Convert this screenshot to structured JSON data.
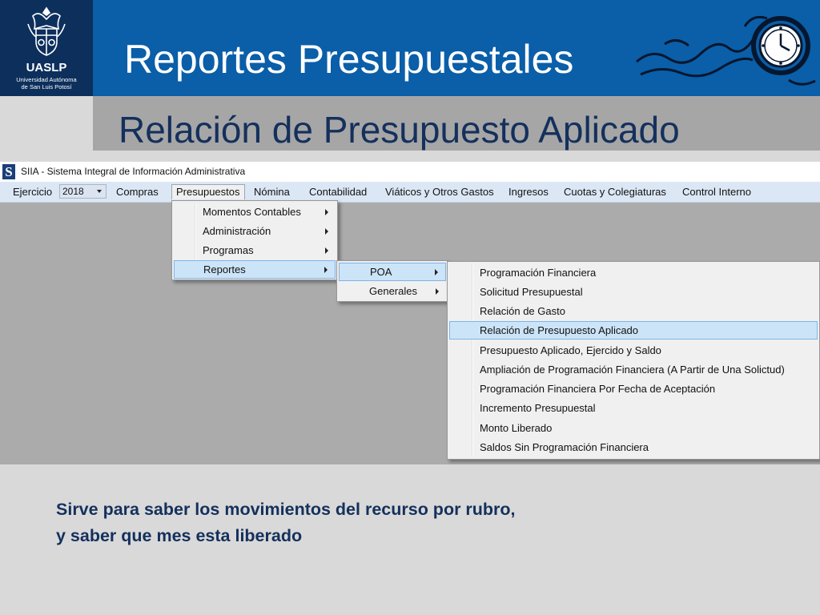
{
  "slide": {
    "logo": {
      "name": "UASLP",
      "line1": "Universidad Autónoma",
      "line2": "de San Luis Potosí"
    },
    "title": "Reportes Presupuestales",
    "subtitle": "Relación de Presupuesto Aplicado",
    "description": [
      "Sirve para saber los movimientos del recurso por rubro,",
      "y saber que mes esta liberado"
    ]
  },
  "app": {
    "window_title": "SIIA - Sistema Integral de Información Administrativa",
    "icon_letter": "S",
    "menubar": {
      "ejercicio_label": "Ejercicio",
      "year_value": "2018",
      "items": [
        "Compras",
        "Presupuestos",
        "Nómina",
        "Contabilidad",
        "Viáticos y Otros Gastos",
        "Ingresos",
        "Cuotas y Colegiaturas",
        "Control Interno"
      ]
    },
    "presupuestos_menu": [
      "Momentos Contables",
      "Administración",
      "Programas",
      "Reportes"
    ],
    "reportes_menu": [
      "POA",
      "Generales"
    ],
    "poa_menu": [
      "Programación Financiera",
      "Solicitud Presupuestal",
      "Relación de Gasto",
      "Relación de Presupuesto Aplicado",
      "Presupuesto Aplicado, Ejercido y Saldo",
      "Ampliación de Programación Financiera (A Partir de Una Solictud)",
      "Programación Financiera Por Fecha de Aceptación",
      "Incremento Presupuestal",
      "Monto Liberado",
      "Saldos Sin Programación Financiera"
    ],
    "selected": {
      "menu": "Presupuestos",
      "submenu": "Reportes",
      "subsubmenu": "POA",
      "item": "Relación de Presupuesto Aplicado"
    }
  },
  "colors": {
    "header_blue": "#0b5ea8",
    "logo_navy": "#0d2f5c",
    "subtitle_gray": "#a6a6a6",
    "text_navy": "#14305c",
    "menu_highlight": "#cce4f7"
  }
}
